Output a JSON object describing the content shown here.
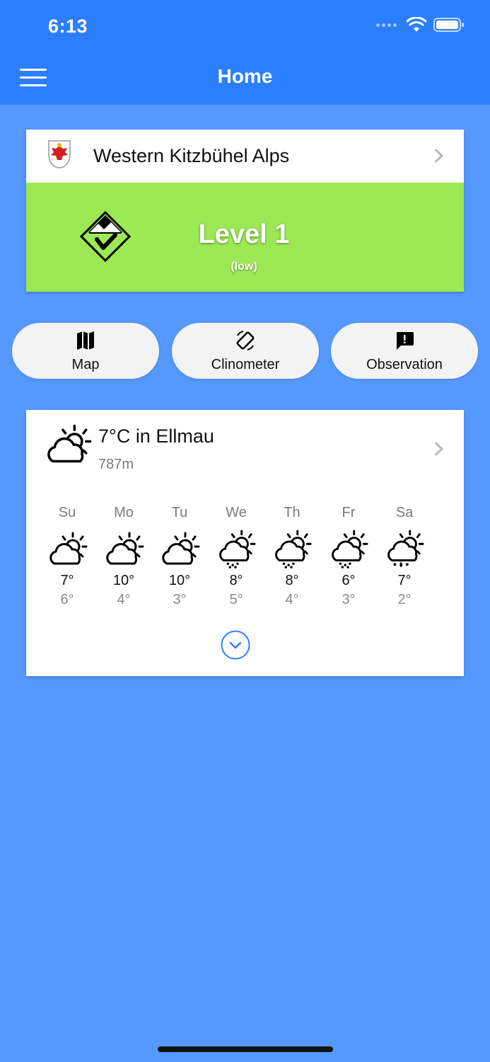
{
  "status_bar": {
    "time": "6:13"
  },
  "header": {
    "title": "Home"
  },
  "danger": {
    "region": "Western Kitzbühel Alps",
    "level_title": "Level 1",
    "level_subtitle": "(low)",
    "level_color": "#9ce855"
  },
  "actions": [
    {
      "label": "Map",
      "icon": "map-icon"
    },
    {
      "label": "Clinometer",
      "icon": "screen-rotation-icon"
    },
    {
      "label": "Observation",
      "icon": "feedback-icon"
    }
  ],
  "weather": {
    "current": "7°C in Ellmau",
    "elevation": "787m",
    "icon": "partly-cloudy-icon",
    "forecast": [
      {
        "day": "Su",
        "high": "7°",
        "low": "6°",
        "icon": "partly-cloudy-icon"
      },
      {
        "day": "Mo",
        "high": "10°",
        "low": "4°",
        "icon": "partly-cloudy-icon"
      },
      {
        "day": "Tu",
        "high": "10°",
        "low": "3°",
        "icon": "partly-cloudy-icon"
      },
      {
        "day": "We",
        "high": "8°",
        "low": "5°",
        "icon": "rain-showers-icon"
      },
      {
        "day": "Th",
        "high": "8°",
        "low": "4°",
        "icon": "rain-showers-icon"
      },
      {
        "day": "Fr",
        "high": "6°",
        "low": "3°",
        "icon": "rain-showers-icon"
      },
      {
        "day": "Sa",
        "high": "7°",
        "low": "2°",
        "icon": "heavy-rain-icon"
      }
    ]
  },
  "colors": {
    "header": "#2b7fff",
    "background": "#5598ff",
    "accent": "#2b7fff"
  }
}
